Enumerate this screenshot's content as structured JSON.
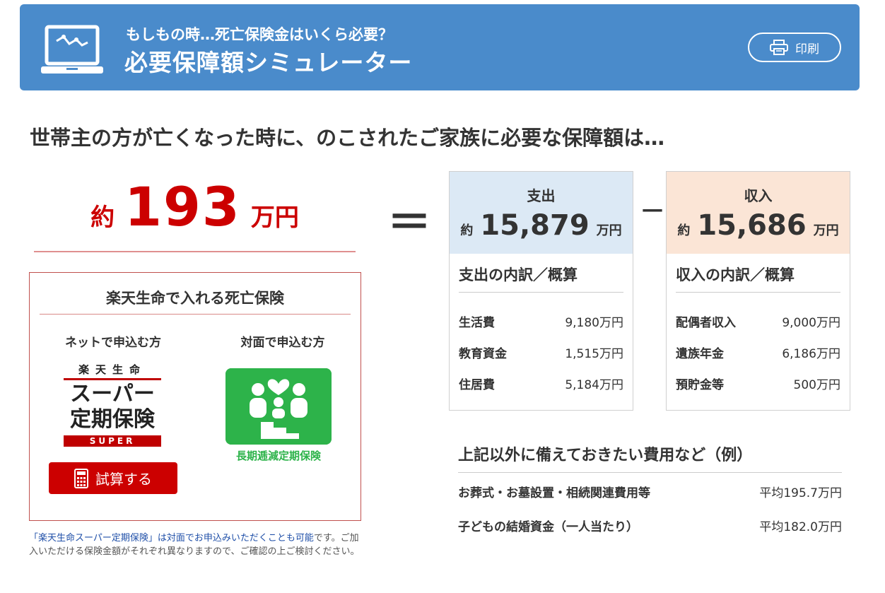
{
  "header": {
    "subtitle": "もしもの時…死亡保険金はいくら必要？",
    "title": "必要保障額シミュレーター",
    "print_label": "印刷"
  },
  "headline": "世帯主の方が亡くなった時に、のこされたご家族に必要な保障額は…",
  "total": {
    "prefix": "約",
    "value": "193",
    "unit": "万円"
  },
  "equals": "＝",
  "minus": "－",
  "expense": {
    "label": "支出",
    "prefix": "約",
    "value": "15,879",
    "unit": "万円",
    "section": "支出の内訳／概算",
    "items": [
      {
        "name": "生活費",
        "value": "9,180万円"
      },
      {
        "name": "教育資金",
        "value": "1,515万円"
      },
      {
        "name": "住居費",
        "value": "5,184万円"
      }
    ]
  },
  "income": {
    "label": "収入",
    "prefix": "約",
    "value": "15,686",
    "unit": "万円",
    "section": "収入の内訳／概算",
    "items": [
      {
        "name": "配偶者収入",
        "value": "9,000万円"
      },
      {
        "name": "遺族年金",
        "value": "6,186万円"
      },
      {
        "name": "預貯金等",
        "value": "500万円"
      }
    ]
  },
  "extras": {
    "title": "上記以外に備えておきたい費用など（例）",
    "items": [
      {
        "name": "お葬式・お墓設置・相続関連費用等",
        "value": "平均195.7万円"
      },
      {
        "name": "子どもの結婚資金（一人当たり）",
        "value": "平均182.0万円"
      }
    ]
  },
  "insurance": {
    "title": "楽天生命で入れる死亡保険",
    "online_label": "ネットで申込む方",
    "inperson_label": "対面で申込む方",
    "logo": {
      "line1": "楽天生命",
      "line2": "スーパー",
      "line3": "定期保険",
      "line4": "SUPER"
    },
    "calc_label": "試算する",
    "ltd_label": "長期逓減定期保険"
  },
  "note": {
    "part1": "「楽天生命スーパー定期保険」は対面でお申込みいただくことも可能",
    "part2": "です。ご加入いただける保険金額がそれぞれ異なりますので、ご確認の上ご検討ください。"
  },
  "colors": {
    "header_bg": "#4a8bcb",
    "accent_red": "#cc0000",
    "expense_bg": "#dce9f5",
    "income_bg": "#fbe5d6",
    "green": "#2db34a"
  }
}
